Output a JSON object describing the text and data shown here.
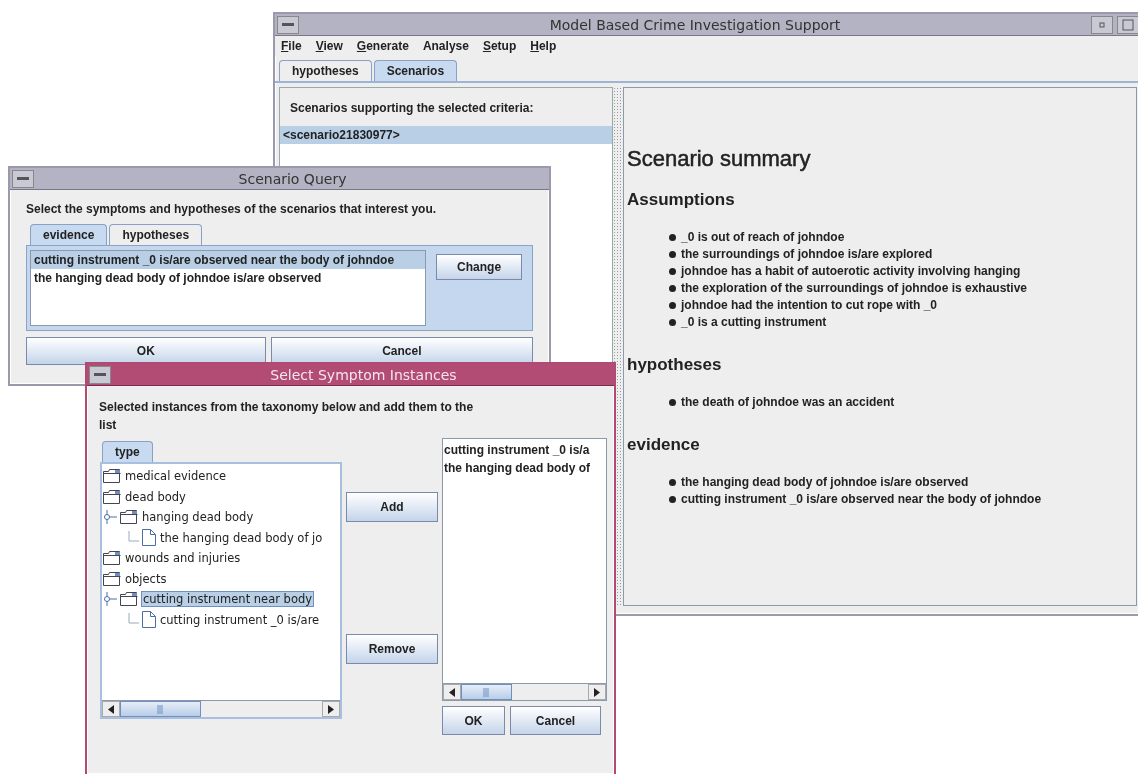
{
  "main_window": {
    "title": "Model Based Crime Investigation Support",
    "menu": [
      {
        "label": "File",
        "mnemonic": true
      },
      {
        "label": "View",
        "mnemonic": true
      },
      {
        "label": "Generate",
        "mnemonic": true
      },
      {
        "label": "Analyse",
        "mnemonic": false
      },
      {
        "label": "Setup",
        "mnemonic": true
      },
      {
        "label": "Help",
        "mnemonic": true
      }
    ],
    "tabs": [
      {
        "label": "hypotheses",
        "selected": false
      },
      {
        "label": "Scenarios",
        "selected": true
      }
    ],
    "scenarios_heading": "Scenarios supporting the selected criteria:",
    "scenarios": [
      {
        "label": "<scenario21830977>",
        "selected": true
      }
    ],
    "summary": {
      "title": "Scenario summary",
      "sections": [
        {
          "heading": "Assumptions",
          "items": [
            "_0 is out of reach of johndoe",
            "the surroundings of johndoe is/are explored",
            "johndoe has a habit of autoerotic activity involving hanging",
            "the exploration of the surroundings of johndoe is exhaustive",
            "johndoe had the intention to cut rope with _0",
            "_0 is a cutting instrument"
          ]
        },
        {
          "heading": "hypotheses",
          "items": [
            "the death of johndoe was an accident"
          ]
        },
        {
          "heading": "evidence",
          "items": [
            "the hanging dead body of johndoe is/are observed",
            "cutting instrument _0 is/are observed near the body of johndoe"
          ]
        }
      ]
    }
  },
  "scenario_query": {
    "title": "Scenario Query",
    "instruction": "Select the symptoms and hypotheses of the scenarios that interest you.",
    "tabs": [
      {
        "label": "evidence",
        "selected": true
      },
      {
        "label": "hypotheses",
        "selected": false
      }
    ],
    "list": [
      {
        "label": "cutting instrument _0 is/are observed near the body of johndoe",
        "selected": true
      },
      {
        "label": "the hanging dead body of johndoe is/are observed",
        "selected": false
      }
    ],
    "side_button": "Change",
    "buttons": [
      "OK",
      "Cancel"
    ]
  },
  "symptom_dialog": {
    "title": "Select Symptom Instances",
    "instruction": "Selected instances from the taxonomy below and add them to the list",
    "tabs": [
      {
        "label": "type",
        "selected": true
      }
    ],
    "tree": [
      {
        "label": "medical evidence",
        "kind": "folder",
        "selected": false
      },
      {
        "label": "dead body",
        "kind": "folder",
        "selected": false,
        "children": [
          {
            "label": "hanging dead body",
            "kind": "folder",
            "selected": false,
            "expanded": true,
            "children": [
              {
                "label": "the hanging dead body of jo",
                "kind": "leaf",
                "selected": false
              }
            ]
          }
        ]
      },
      {
        "label": "wounds and injuries",
        "kind": "folder",
        "selected": false
      },
      {
        "label": "objects",
        "kind": "folder",
        "selected": false,
        "children": [
          {
            "label": "cutting instrument near body",
            "kind": "folder",
            "selected": true,
            "expanded": true,
            "children": [
              {
                "label": "cutting instrument _0 is/are",
                "kind": "leaf",
                "selected": false
              }
            ]
          }
        ]
      }
    ],
    "add_button": "Add",
    "remove_button": "Remove",
    "selected_list": [
      "cutting instrument _0 is/a",
      "the hanging dead body of"
    ],
    "buttons": [
      "OK",
      "Cancel"
    ]
  }
}
